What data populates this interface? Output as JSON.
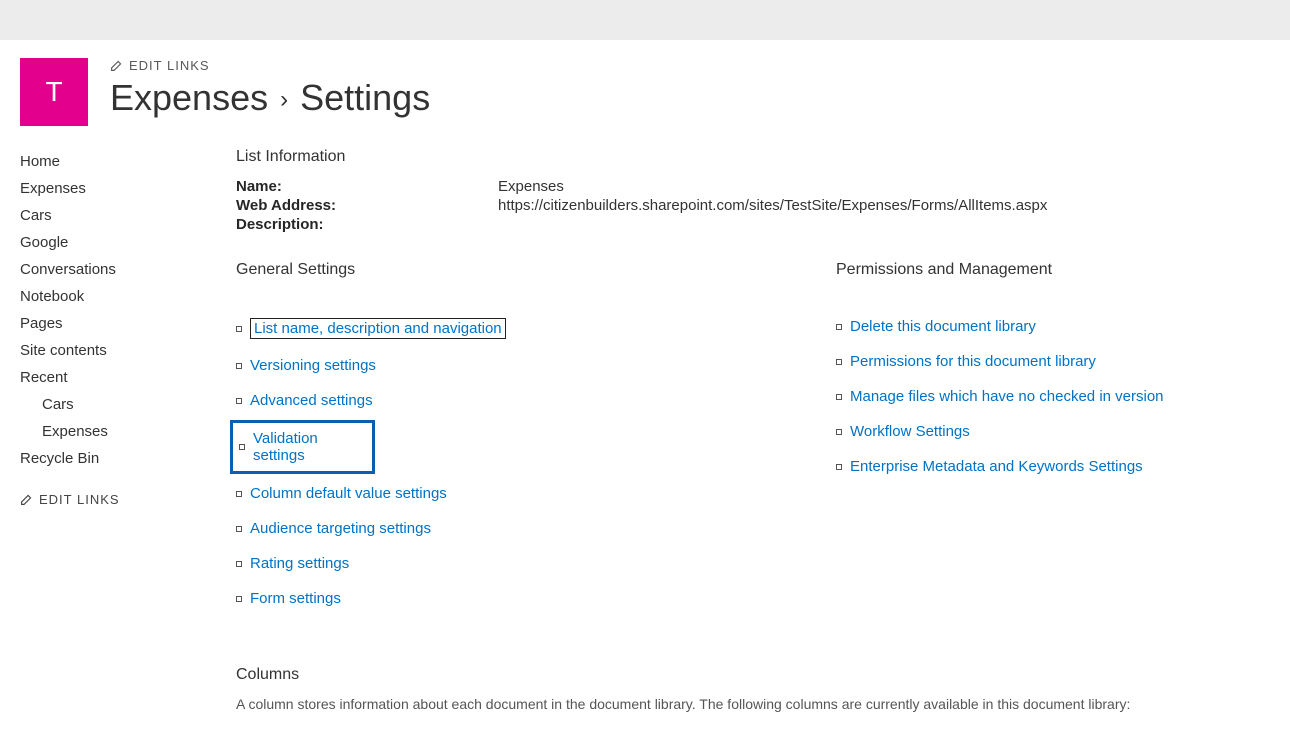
{
  "site": {
    "logo_letter": "T",
    "edit_links_label": "EDIT LINKS"
  },
  "breadcrumb": {
    "list_name": "Expenses",
    "page": "Settings"
  },
  "quick_launch": {
    "items": [
      {
        "label": "Home",
        "indent": false
      },
      {
        "label": "Expenses",
        "indent": false
      },
      {
        "label": "Cars",
        "indent": false
      },
      {
        "label": "Google",
        "indent": false
      },
      {
        "label": "Conversations",
        "indent": false
      },
      {
        "label": "Notebook",
        "indent": false
      },
      {
        "label": "Pages",
        "indent": false
      },
      {
        "label": "Site contents",
        "indent": false
      },
      {
        "label": "Recent",
        "indent": false
      },
      {
        "label": "Cars",
        "indent": true
      },
      {
        "label": "Expenses",
        "indent": true
      },
      {
        "label": "Recycle Bin",
        "indent": false
      }
    ],
    "edit_links_label": "EDIT LINKS"
  },
  "list_info": {
    "heading": "List Information",
    "name_label": "Name:",
    "name_value": "Expenses",
    "web_address_label": "Web Address:",
    "web_address_value": "https://citizenbuilders.sharepoint.com/sites/TestSite/Expenses/Forms/AllItems.aspx",
    "description_label": "Description:"
  },
  "general_settings": {
    "heading": "General Settings",
    "links": [
      "List name, description and navigation",
      "Versioning settings",
      "Advanced settings",
      "Validation settings",
      "Column default value settings",
      "Audience targeting settings",
      "Rating settings",
      "Form settings"
    ],
    "focused_index": 0,
    "highlighted_index": 3
  },
  "permissions": {
    "heading": "Permissions and Management",
    "links": [
      "Delete this document library",
      "Permissions for this document library",
      "Manage files which have no checked in version",
      "Workflow Settings",
      "Enterprise Metadata and Keywords Settings"
    ]
  },
  "columns": {
    "heading": "Columns",
    "description": "A column stores information about each document in the document library. The following columns are currently available in this document library:"
  }
}
